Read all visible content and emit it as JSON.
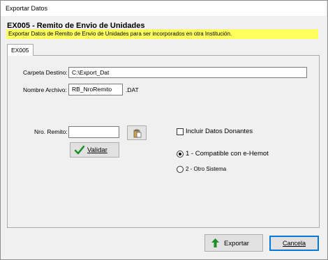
{
  "window": {
    "title": "Exportar Datos"
  },
  "header": {
    "title": "EX005 - Remito de Envio de Unidades",
    "subtitle": "Exportar Datos de Remito de Envio de Unidades para ser incorporados en otra Institución."
  },
  "tabs": [
    {
      "label": "EX005",
      "selected": true
    }
  ],
  "form": {
    "carpeta_label": "Carpeta Destino:",
    "carpeta_value": "C:\\Export_Dat",
    "archivo_label": "Nombre Archivo:",
    "archivo_value": "RB_NroRemito",
    "archivo_ext": ".DAT",
    "remito_label": "Nro. Remito:",
    "remito_value": "",
    "validar_label": "Validar",
    "incluir_label": "Incluir Datos Donantes",
    "incluir_checked": false,
    "radio_options": [
      {
        "label": "1 - Compatible con e-Hemot",
        "selected": true
      },
      {
        "label": "2 - Otro Sistema",
        "selected": false
      }
    ]
  },
  "footer": {
    "exportar_label": "Exportar",
    "cancelar_label": "Cancela"
  },
  "colors": {
    "banner": "#ffff5e",
    "accent_green": "#1a8f2a",
    "focus_border": "#0078d7"
  },
  "icons": [
    "check-icon",
    "paste-icon",
    "up-arrow-icon"
  ]
}
